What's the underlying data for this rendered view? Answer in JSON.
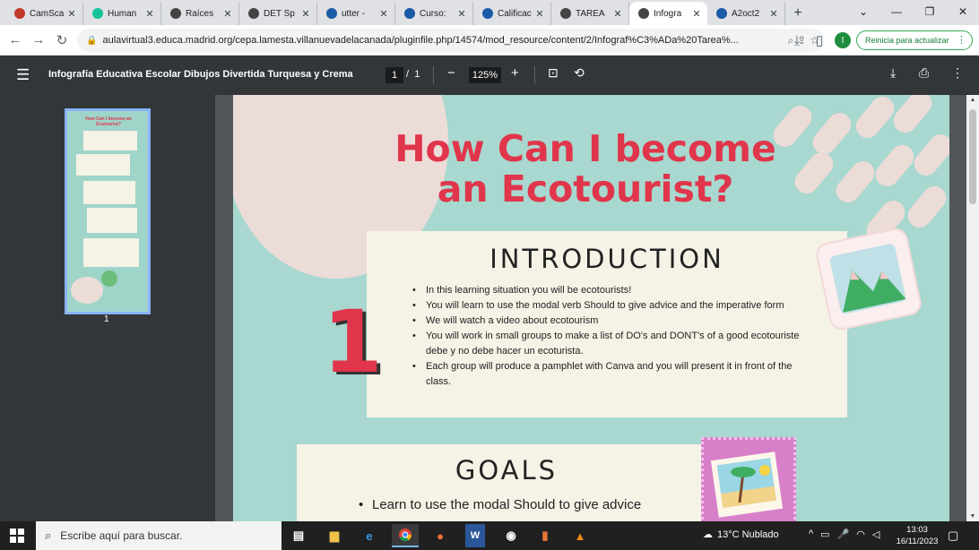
{
  "browser": {
    "tabs": [
      {
        "title": "CamSca",
        "icon": "camscanner-icon",
        "color": "#c0392b"
      },
      {
        "title": "Human",
        "icon": "grammarly-icon",
        "color": "#15c39a"
      },
      {
        "title": "Raíces",
        "icon": "globe-icon",
        "color": "#444444"
      },
      {
        "title": "DET Sp",
        "icon": "globe-icon",
        "color": "#444444"
      },
      {
        "title": "utter - ",
        "icon": "wordreference-icon",
        "color": "#1a5aa6"
      },
      {
        "title": "Curso: ",
        "icon": "moodle-cap-icon",
        "color": "#1a5aa6"
      },
      {
        "title": "Calificac",
        "icon": "moodle-cap-icon",
        "color": "#1a5aa6"
      },
      {
        "title": "TAREA ",
        "icon": "globe-icon",
        "color": "#444444"
      },
      {
        "title": "Infogra",
        "icon": "globe-icon",
        "color": "#444444",
        "active": true
      },
      {
        "title": "A2oct2",
        "icon": "moodle-cap-icon",
        "color": "#1a5aa6"
      }
    ],
    "url": "aulavirtual3.educa.madrid.org/cepa.lamesta.villanuevadelacanada/pluginfile.php/14574/mod_resource/content/2/Infograf%C3%ADa%20Tarea%...",
    "profile_initial": "I",
    "restart_label": "Reinicia para actualizar"
  },
  "pdf": {
    "title": "Infografía Educativa Escolar Dibujos Divertida Turquesa y Crema",
    "current_page": "1",
    "page_separator": "/",
    "total_pages": "1",
    "zoom": "125%",
    "thumbnail_label": "1"
  },
  "document": {
    "heading": "How Can I become an Ecotourist?",
    "section_number": "1",
    "introduction": {
      "title": "INTRODUCTION",
      "items": [
        "In this learning situation you will be ecotourists!",
        "You will learn to use the modal verb Should to give advice and the imperative form",
        "We will watch a video about ecotourism",
        "You will work in small groups to make a list of DO's and DONT's of a good ecotouriste debe y no debe hacer un ecoturista.",
        "Each group will produce a pamphlet with Canva and you will present it in front of the class."
      ]
    },
    "goals": {
      "title": "GOALS",
      "items": [
        "Learn to use the modal Should to give advice"
      ]
    }
  },
  "taskbar": {
    "search_placeholder": "Escribe aquí para buscar.",
    "weather": "13°C  Nublado",
    "time": "13:03",
    "date": "16/11/2023"
  },
  "colors": {
    "accent_red": "#e0354b",
    "page_bg": "#a8d8cf",
    "card_bg": "#f5f2e6"
  }
}
